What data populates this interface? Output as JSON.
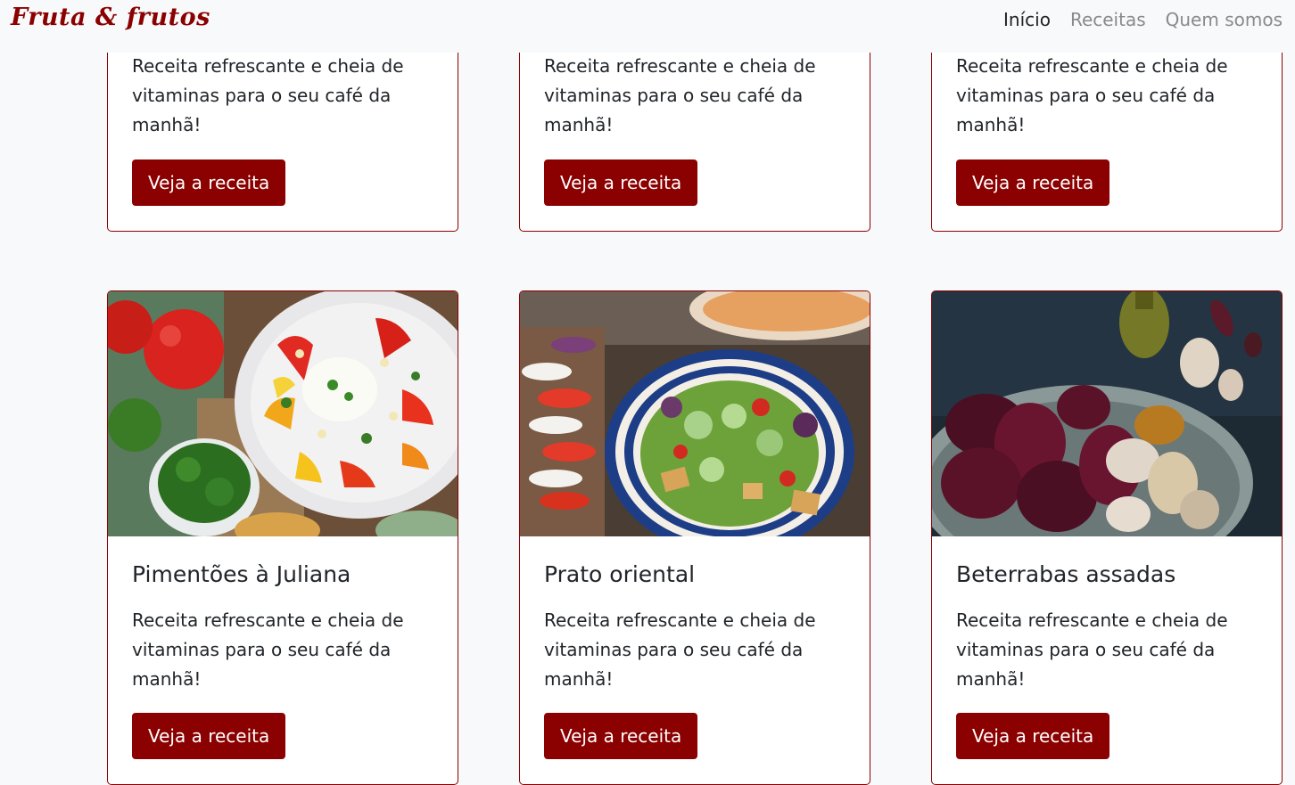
{
  "navbar": {
    "brand": "Fruta & frutos",
    "links": [
      "Início",
      "Receitas",
      "Quem somos"
    ]
  },
  "top_cards": [
    {
      "text": "Receita refrescante e cheia de vitaminas para o seu café da manhã!",
      "button": "Veja a receita"
    },
    {
      "text": "Receita refrescante e cheia de vitaminas para o seu café da manhã!",
      "button": "Veja a receita"
    },
    {
      "text": "Receita refrescante e cheia de vitaminas para o seu café da manhã!",
      "button": "Veja a receita"
    }
  ],
  "bottom_cards": [
    {
      "title": "Pimentões à Juliana",
      "text": "Receita refrescante e cheia de vitaminas para o seu café da manhã!",
      "button": "Veja a receita",
      "image": "salad-peppers-burrata-photo"
    },
    {
      "title": "Prato oriental",
      "text": "Receita refrescante e cheia de vitaminas para o seu café da manhã!",
      "button": "Veja a receita",
      "image": "salad-bowl-cucumber-photo"
    },
    {
      "title": "Beterrabas assadas",
      "text": "Receita refrescante e cheia de vitaminas para o seu café da manhã!",
      "button": "Veja a receita",
      "image": "roasted-beets-garlic-photo"
    }
  ],
  "colors": {
    "brand": "#8b0000",
    "background": "#f8f9fa"
  }
}
